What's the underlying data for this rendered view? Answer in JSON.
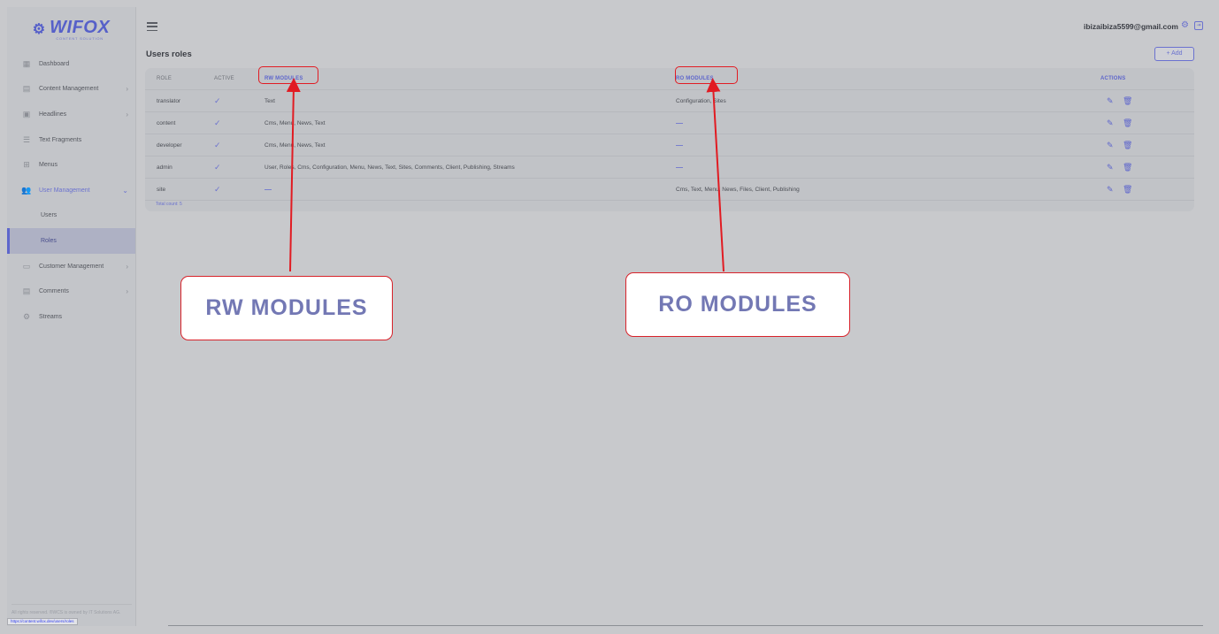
{
  "brand": {
    "name": "WIFOX",
    "tagline": "CONTENT SOLUTION"
  },
  "sidebar": {
    "items": [
      {
        "label": "Dashboard",
        "icon": "dashboard-icon",
        "glyph": "▦",
        "chevron": ""
      },
      {
        "label": "Content Management",
        "icon": "content-icon",
        "glyph": "▤",
        "chevron": "›"
      },
      {
        "label": "Headlines",
        "icon": "headlines-icon",
        "glyph": "▣",
        "chevron": "›"
      },
      {
        "label": "Text Fragments",
        "icon": "text-fragments-icon",
        "glyph": "☰",
        "chevron": ""
      },
      {
        "label": "Menus",
        "icon": "menus-icon",
        "glyph": "⊞",
        "chevron": ""
      },
      {
        "label": "User Management",
        "icon": "users-icon",
        "glyph": "👥",
        "chevron": "⌄"
      },
      {
        "label": "Customer Management",
        "icon": "customer-icon",
        "glyph": "▭",
        "chevron": "›"
      },
      {
        "label": "Comments",
        "icon": "comments-icon",
        "glyph": "▤",
        "chevron": "›"
      },
      {
        "label": "Streams",
        "icon": "streams-icon",
        "glyph": "⚙",
        "chevron": ""
      }
    ],
    "subitems": [
      {
        "label": "Users"
      },
      {
        "label": "Roles"
      }
    ],
    "footer": "All rights reserved. ®WCS is owned by IT Solutions AG.",
    "status_url": "https://content.wifox.dev/users/roles"
  },
  "topbar": {
    "user_email": "ibizaibiza5599@gmail.com"
  },
  "page": {
    "title": "Users roles",
    "add_label": "+ Add"
  },
  "table": {
    "headers": {
      "role": "ROLE",
      "active": "ACTIVE",
      "rw": "RW MODULES",
      "ro": "RO MODULES",
      "actions": "ACTIONS"
    },
    "rows": [
      {
        "role": "translator",
        "active": "✓",
        "rw": "Text",
        "ro": "Configuration, Sites"
      },
      {
        "role": "content",
        "active": "✓",
        "rw": "Cms, Menu, News, Text",
        "ro": "—"
      },
      {
        "role": "developer",
        "active": "✓",
        "rw": "Cms, Menu, News, Text",
        "ro": "—"
      },
      {
        "role": "admin",
        "active": "✓",
        "rw": "User, Roles, Cms, Configuration, Menu, News, Text, Sites, Comments, Client, Publishing, Streams",
        "ro": "—"
      },
      {
        "role": "site",
        "active": "✓",
        "rw": "—",
        "ro": "Cms, Text, Menu, News, Files, Client, Publishing"
      }
    ],
    "total": "Total count: 5"
  },
  "callouts": {
    "rw": "RW MODULES",
    "ro": "RO MODULES"
  },
  "colors": {
    "accent": "#6b72cf",
    "highlight": "#e11b22"
  }
}
